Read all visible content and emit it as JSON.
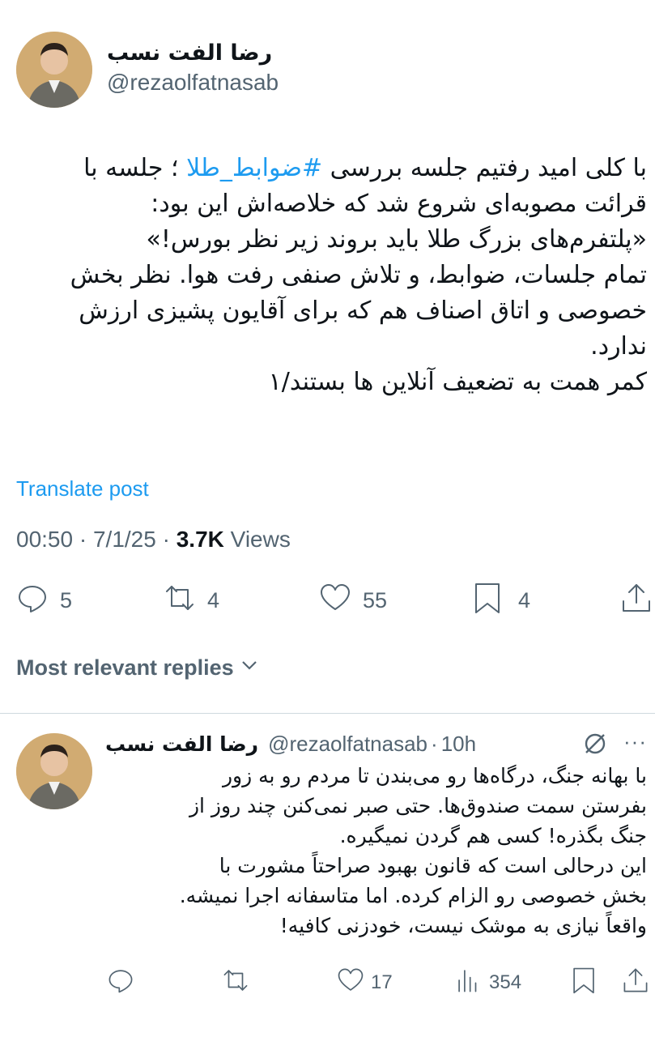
{
  "post": {
    "author_name": "رضا الفت نسب",
    "author_handle": "@rezaolfatnasab",
    "text_lines": [
      {
        "before": "با کلی امید رفتیم جلسه بررسی ",
        "hashtag": "#ضوابط_طلا",
        "after": " ؛ جلسه با"
      },
      "قرائت مصوبه‌ای شروع شد که خلاصه‌اش این بود:",
      "«پلتفرم‌های بزرگ طلا باید بروند زیر نظر بورس!»",
      "تمام جلسات، ضوابط، و تلاش صنفی رفت هوا. نظر بخش",
      "خصوصی و اتاق اصناف هم که برای آقایون پشیزی ارزش",
      "ندارد.",
      "کمر همت به تضعیف آنلاین ها بستند/۱"
    ],
    "translate_label": "Translate post",
    "time": "00:50",
    "date": "7/1/25",
    "views_count": "3.7K",
    "views_label": "Views",
    "replies_count": "5",
    "reposts_count": "4",
    "likes_count": "55",
    "bookmarks_count": "4"
  },
  "replies_sort_label": "Most relevant replies",
  "reply": {
    "author_name": "رضا الفت نسب",
    "author_handle": "@rezaolfatnasab",
    "time": "10h",
    "text_lines": [
      "با بهانه جنگ، درگاه‌ها رو می‌بندن تا مردم رو به زور",
      "بفرستن سمت صندوق‌ها. حتی صبر نمی‌کنن چند روز از",
      "جنگ بگذره! کسی هم گردن نمیگیره.",
      "این درحالی است که قانون بهبود صراحتاً مشورت با",
      "بخش خصوصی رو الزام کرده. اما متاسفانه اجرا نمیشه.",
      "واقعاً نیازی به موشک نیست، خودزنی کافیه!"
    ],
    "likes_count": "17",
    "views_count": "354"
  },
  "colors": {
    "accent": "#1d9bf0",
    "secondary_text": "#536471",
    "primary_text": "#0f1419",
    "divider": "#cfd9de"
  },
  "icons": [
    "reply-icon",
    "repost-icon",
    "like-icon",
    "bookmark-icon",
    "share-icon",
    "chevron-down-icon",
    "grok-icon",
    "more-icon",
    "views-icon"
  ]
}
